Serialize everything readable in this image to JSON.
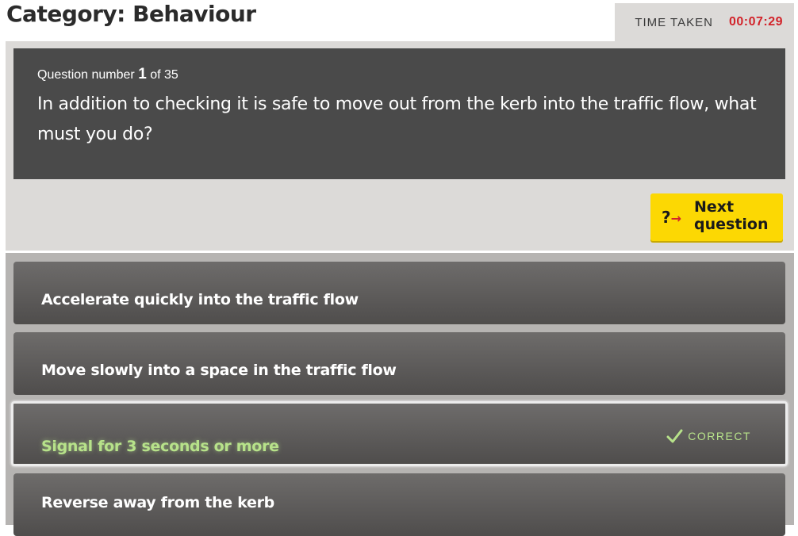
{
  "header": {
    "title": "Category: Behaviour",
    "timer_label": "TIME TAKEN",
    "timer_value": "00:07:29"
  },
  "question": {
    "prefix": "Question number",
    "number": "1",
    "of_text": "of 35",
    "text": "In addition to checking it is safe to move out from the kerb into the traffic flow, what must you do?"
  },
  "next_button": {
    "icon": "?",
    "label": "Next question"
  },
  "answers": [
    {
      "label": "Accelerate quickly into the traffic flow",
      "correct": false
    },
    {
      "label": "Move slowly into a space in the traffic flow",
      "correct": false
    },
    {
      "label": "Signal for 3 seconds or more",
      "correct": true,
      "badge": "CORRECT"
    },
    {
      "label": "Reverse away from the kerb",
      "correct": false
    }
  ],
  "colors": {
    "accent_yellow": "#fcd803",
    "timer_red": "#d2232a",
    "correct_green": "#b7e28a",
    "panel_dark": "#4a4a4a"
  }
}
